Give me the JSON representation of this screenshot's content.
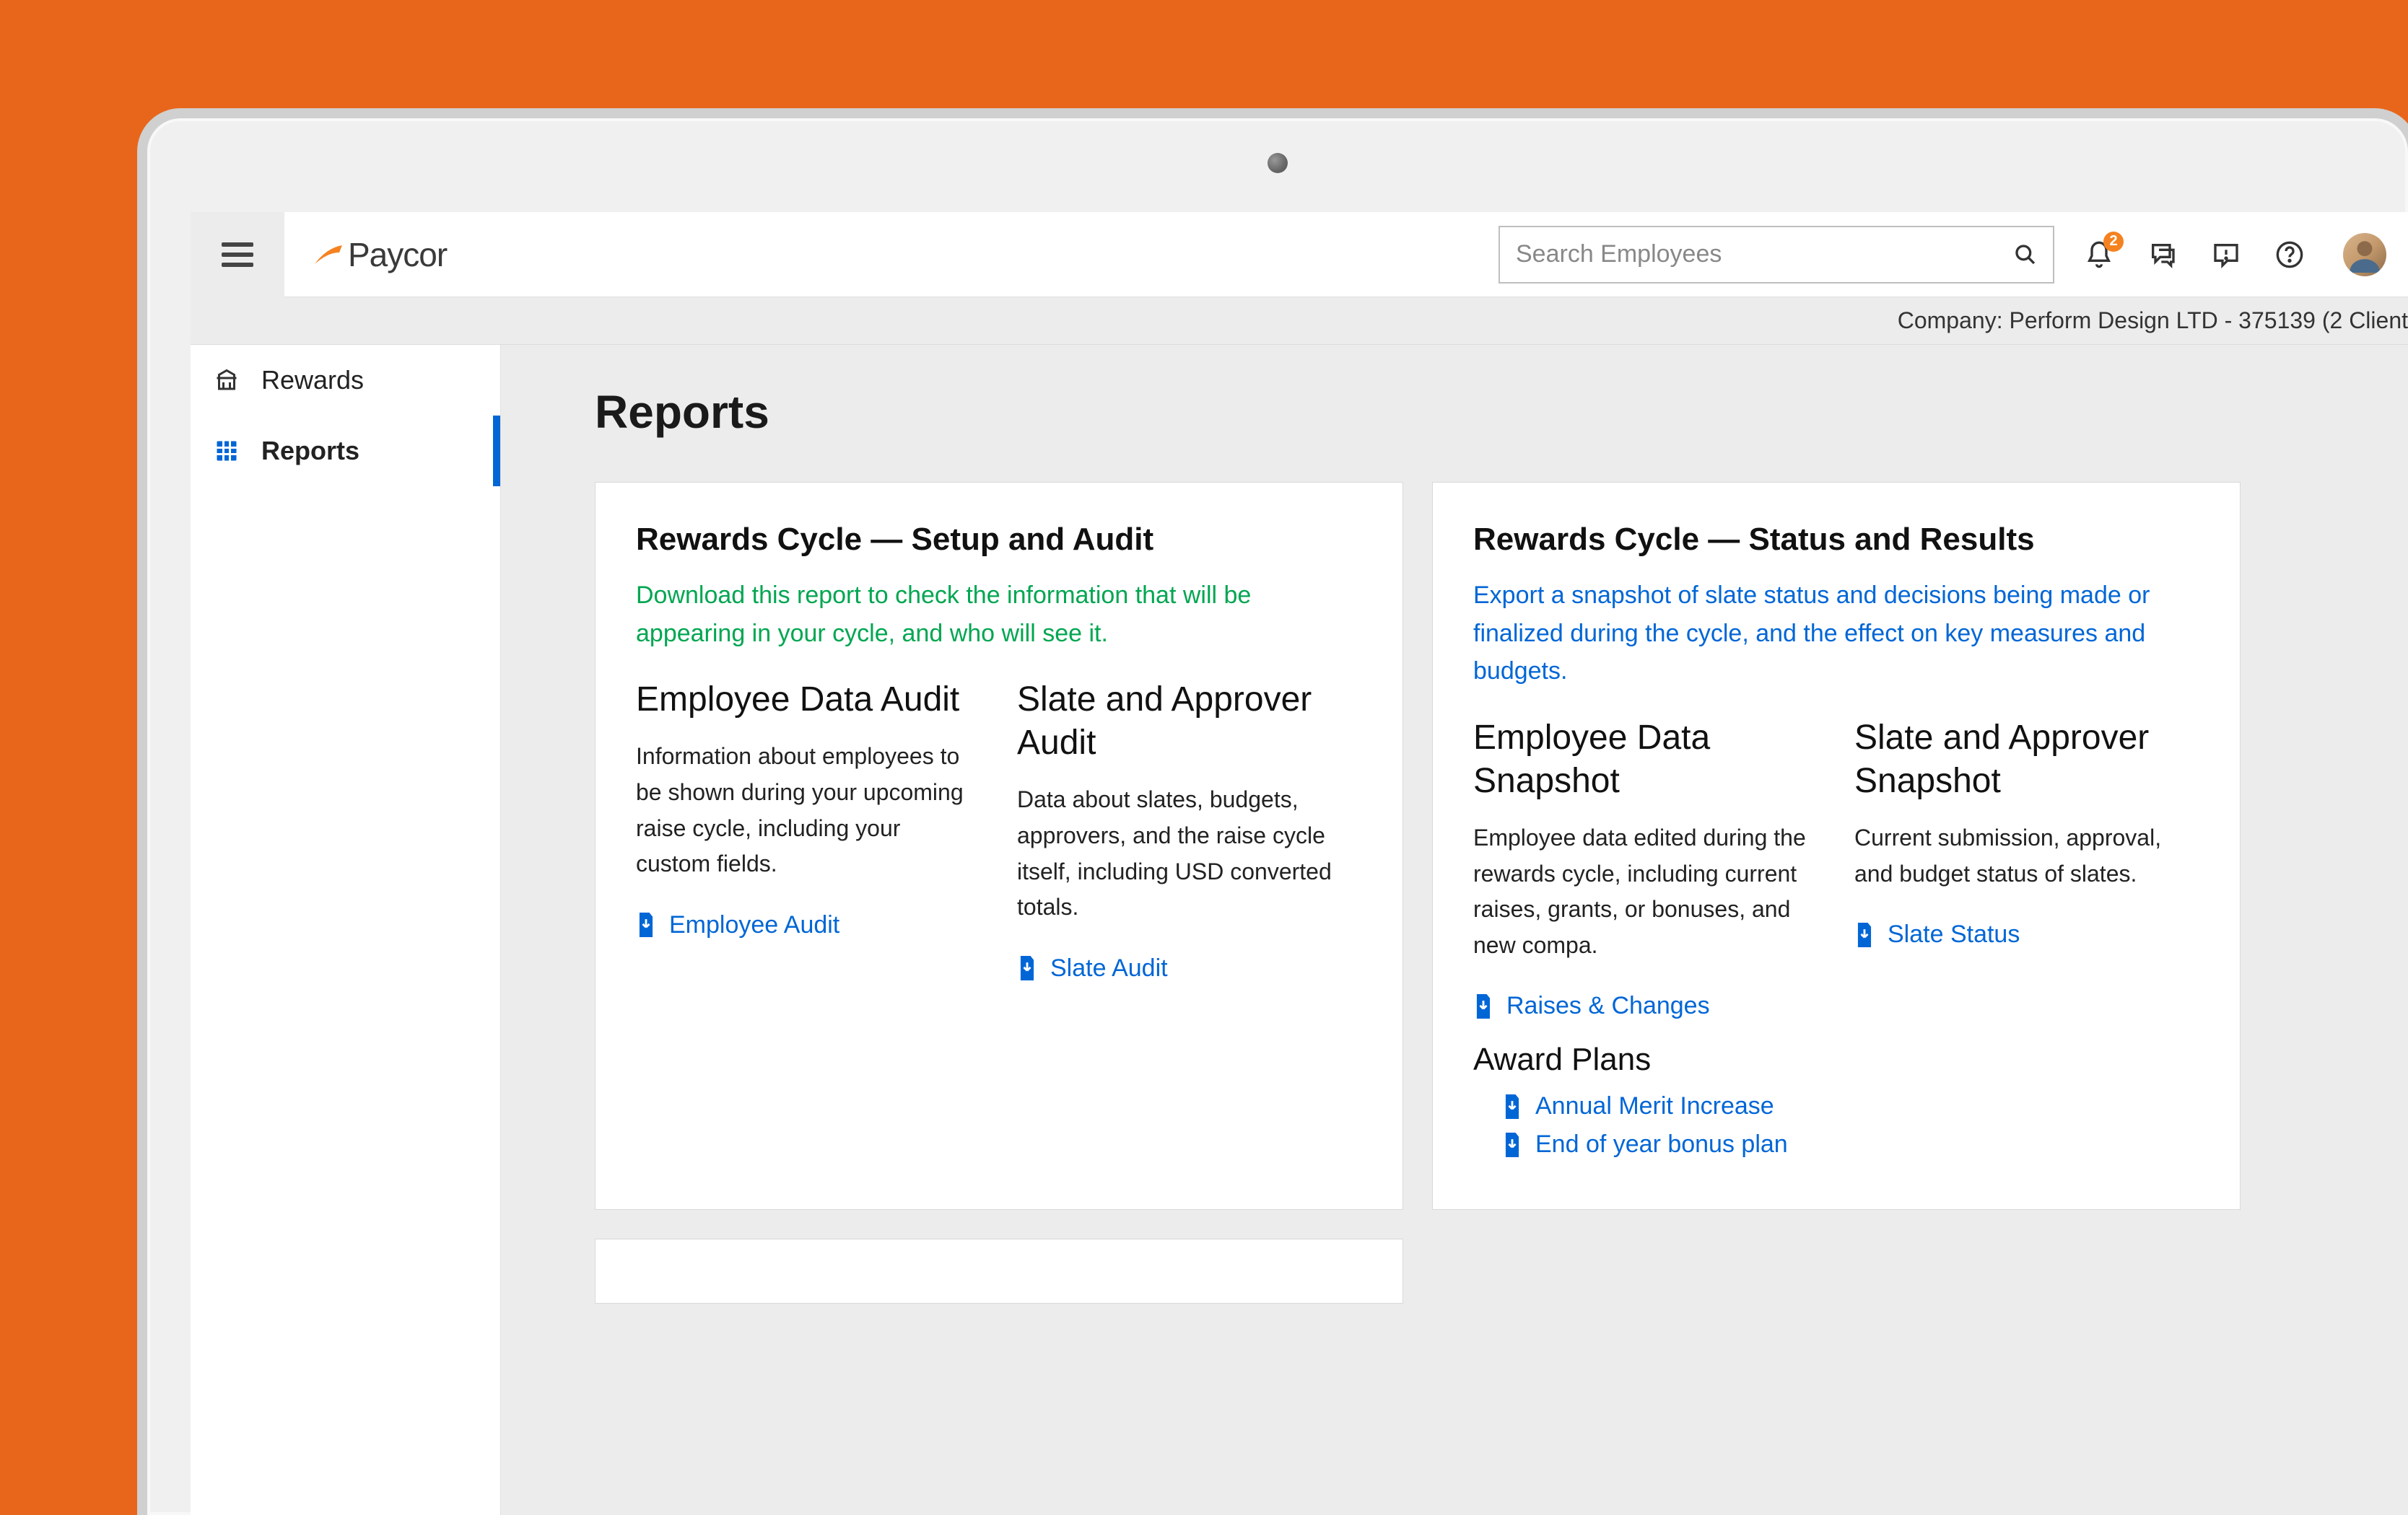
{
  "logo": {
    "text": "Paycor"
  },
  "search": {
    "placeholder": "Search Employees"
  },
  "notifications": {
    "count": "2"
  },
  "company_strip": "Company: Perform Design LTD - 375139 (2 Client",
  "sidebar": {
    "items": [
      {
        "label": "Rewards"
      },
      {
        "label": "Reports"
      }
    ]
  },
  "page": {
    "title": "Reports"
  },
  "cards": [
    {
      "title": "Rewards Cycle — Setup and Audit",
      "subtitle": "Download this report to check the information that will be appearing in your cycle, and who will see it.",
      "columns": [
        {
          "heading": "Employee Data Audit",
          "body": "Information about employees to be shown during your upcoming raise cycle, including your custom fields.",
          "link": "Employee Audit"
        },
        {
          "heading": "Slate and Approver Audit",
          "body": "Data about slates, budgets, approvers, and the raise cycle itself, including USD converted totals.",
          "link": "Slate Audit"
        }
      ]
    },
    {
      "title": "Rewards Cycle — Status and Results",
      "subtitle": "Export a snapshot of slate status and decisions being made or finalized during the cycle, and the effect on key measures and budgets.",
      "columns": [
        {
          "heading": "Employee Data Snapshot",
          "body": "Employee data edited during the rewards cycle, including current raises, grants, or bonuses, and new compa.",
          "link": "Raises & Changes"
        },
        {
          "heading": "Slate and Approver Snapshot",
          "body": "Current submission, approval, and budget status of slates.",
          "link": "Slate Status"
        }
      ],
      "plans": {
        "title": "Award Plans",
        "links": [
          "Annual Merit Increase",
          "End of year bonus plan"
        ]
      }
    }
  ]
}
